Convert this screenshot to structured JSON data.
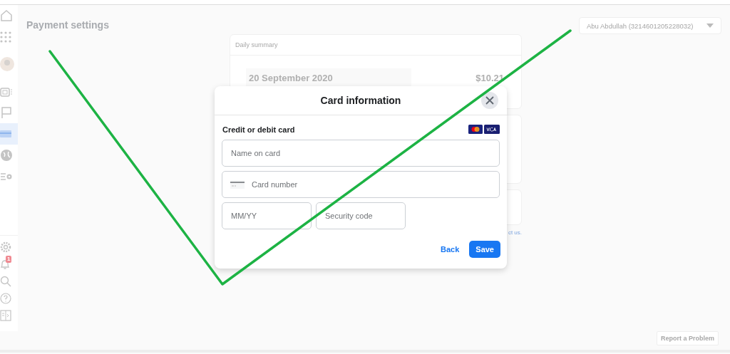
{
  "page": {
    "title": "Payment settings"
  },
  "account_dropdown": {
    "value": "Abu Abdullah (3214601205228032)"
  },
  "sidebar": {
    "top_items": [
      {
        "kind": "home",
        "selected": false
      },
      {
        "kind": "apps",
        "selected": false
      },
      {
        "kind": "avatar",
        "selected": false
      },
      {
        "kind": "briefcase",
        "selected": false
      },
      {
        "kind": "flag",
        "selected": false
      },
      {
        "kind": "card",
        "selected": true
      },
      {
        "kind": "globe",
        "selected": false
      },
      {
        "kind": "list-settings",
        "selected": false
      }
    ],
    "bottom_items": [
      {
        "kind": "settings",
        "selected": false
      },
      {
        "kind": "bell",
        "selected": false,
        "badge": "1"
      },
      {
        "kind": "search",
        "selected": false
      },
      {
        "kind": "help",
        "selected": false
      },
      {
        "kind": "panel",
        "selected": false
      }
    ]
  },
  "daily_summary": {
    "title": "Daily summary",
    "rows": [
      {
        "date": "20 September 2020",
        "amount": "$10.21"
      }
    ],
    "footnote": "ct us."
  },
  "modal": {
    "title": "Card information",
    "section": "Credit or debit card",
    "fields": [
      {
        "kind": "name",
        "placeholder": "Name on card"
      },
      {
        "kind": "card",
        "placeholder": "Card number"
      },
      {
        "kind": "expiry",
        "placeholder": "MM/YY"
      },
      {
        "kind": "cvc",
        "placeholder": "Security code"
      }
    ],
    "buttons": [
      {
        "kind": "link",
        "label": "Back"
      },
      {
        "kind": "primary",
        "label": "Save"
      }
    ]
  },
  "report_button": {
    "label": "Report a Problem"
  }
}
